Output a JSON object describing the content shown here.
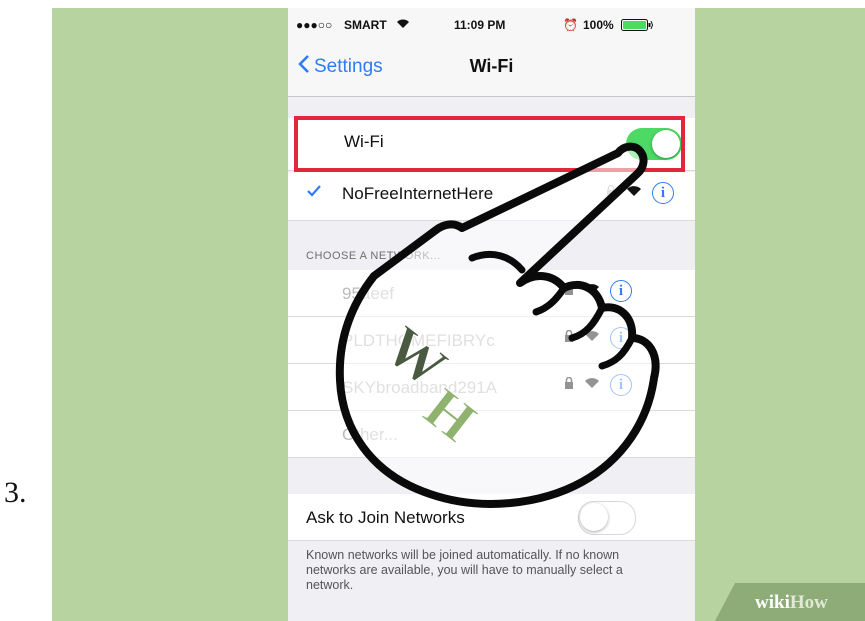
{
  "step_number": "3.",
  "status_bar": {
    "carrier": "SMART",
    "time": "11:09 PM",
    "battery": "100%"
  },
  "nav": {
    "back_label": "Settings",
    "title": "Wi-Fi"
  },
  "wifi_row": {
    "label": "Wi-Fi",
    "enabled": true
  },
  "connected_network": {
    "name": "NoFreeInternetHere"
  },
  "section_header": "CHOOSE A NETWORK...",
  "networks": [
    {
      "name": "95aeef"
    },
    {
      "name": "PLDTHOMEFIBRYc"
    },
    {
      "name": "SKYbroadband291A"
    }
  ],
  "other_label": "Other...",
  "ask_row": {
    "label": "Ask to Join Networks",
    "enabled": false
  },
  "footer_text": "Known networks will be joined automatically. If no known networks are available, you will have to manually select a network.",
  "watermark": {
    "wiki": "wiki",
    "how": "How"
  },
  "logo_text": "wH",
  "colors": {
    "background": "#b7d39f",
    "ios_blue": "#2f7cf6",
    "toggle_green": "#4cd964",
    "highlight_red": "#e0283a"
  }
}
